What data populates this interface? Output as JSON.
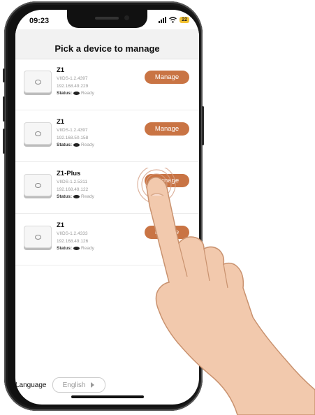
{
  "status_bar": {
    "time": "09:23",
    "battery": "22"
  },
  "header": {
    "title": "Pick a device to manage"
  },
  "devices": [
    {
      "name": "Z1",
      "firmware": "VIIDS-1.2.4397",
      "ip": "192.168.49.229",
      "status_label": "Status:",
      "status_value": "Ready",
      "button": "Manage"
    },
    {
      "name": "Z1",
      "firmware": "VIIDS-1.2.4397",
      "ip": "192.168.50.158",
      "status_label": "Status:",
      "status_value": "Ready",
      "button": "Manage"
    },
    {
      "name": "Z1-Plus",
      "firmware": "VIIDS-1.2.5311",
      "ip": "192.168.49.122",
      "status_label": "Status:",
      "status_value": "Ready",
      "button": "Manage"
    },
    {
      "name": "Z1",
      "firmware": "VIIDS-1.2.4333",
      "ip": "192.168.49.126",
      "status_label": "Status:",
      "status_value": "Ready",
      "button": "Manage"
    }
  ],
  "language": {
    "label": "Language",
    "value": "English"
  },
  "colors": {
    "accent": "#c97444",
    "header_bg": "#f2f2f2",
    "frame": "#111111"
  }
}
